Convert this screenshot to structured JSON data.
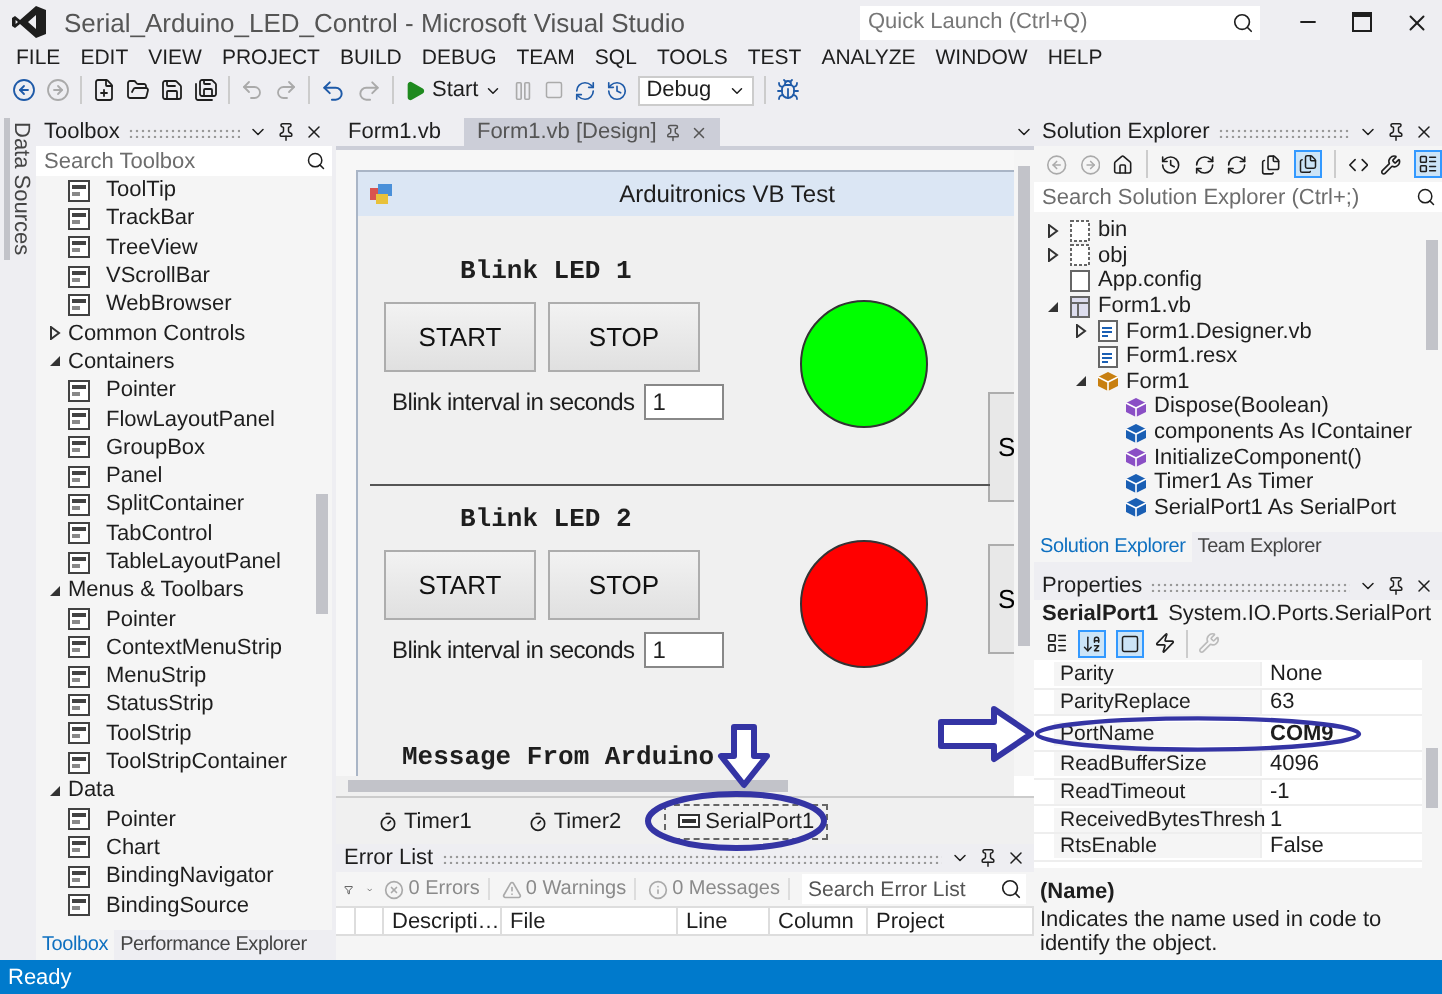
{
  "window": {
    "title": "Serial_Arduino_LED_Control - Microsoft Visual Studio"
  },
  "quick_launch": {
    "placeholder": "Quick Launch (Ctrl+Q)"
  },
  "menu": [
    "FILE",
    "EDIT",
    "VIEW",
    "PROJECT",
    "BUILD",
    "DEBUG",
    "TEAM",
    "SQL",
    "TOOLS",
    "TEST",
    "ANALYZE",
    "WINDOW",
    "HELP"
  ],
  "toolbar": {
    "start": "Start",
    "configuration": "Debug"
  },
  "side_strip": {
    "label": "Data Sources"
  },
  "toolbox": {
    "title": "Toolbox",
    "search": {
      "placeholder": "Search Toolbox"
    },
    "loose_items": [
      "ToolTip",
      "TrackBar",
      "TreeView",
      "VScrollBar",
      "WebBrowser"
    ],
    "groups": [
      {
        "label": "Common Controls",
        "expanded": false
      },
      {
        "label": "Containers",
        "expanded": true,
        "items": [
          "Pointer",
          "FlowLayoutPanel",
          "GroupBox",
          "Panel",
          "SplitContainer",
          "TabControl",
          "TableLayoutPanel"
        ]
      },
      {
        "label": "Menus & Toolbars",
        "expanded": true,
        "items": [
          "Pointer",
          "ContextMenuStrip",
          "MenuStrip",
          "StatusStrip",
          "ToolStrip",
          "ToolStripContainer"
        ]
      },
      {
        "label": "Data",
        "expanded": true,
        "items": [
          "Pointer",
          "Chart",
          "BindingNavigator",
          "BindingSource"
        ]
      }
    ],
    "tabs": [
      {
        "label": "Toolbox",
        "selected": true
      },
      {
        "label": "Performance Explorer",
        "selected": false
      }
    ]
  },
  "documents": {
    "tabs": [
      {
        "label": "Form1.vb",
        "selected": false
      },
      {
        "label": "Form1.vb [Design]",
        "selected": true
      }
    ]
  },
  "form": {
    "title": "Arduitronics VB Test",
    "sections": [
      {
        "title": "Blink LED 1",
        "buttons": [
          "START",
          "STOP"
        ],
        "interval_label": "Blink interval in seconds",
        "interval_value": "1",
        "color": "#00ff00",
        "side_button": "S"
      },
      {
        "title": "Blink LED 2",
        "buttons": [
          "START",
          "STOP"
        ],
        "interval_label": "Blink interval in seconds",
        "interval_value": "1",
        "color": "#ff0000",
        "side_button": "S"
      }
    ],
    "message_label": "Message From Arduino"
  },
  "component_tray": [
    {
      "label": "Timer1",
      "kind": "timer",
      "selected": false,
      "circled": false
    },
    {
      "label": "Timer2",
      "kind": "timer",
      "selected": false,
      "circled": false
    },
    {
      "label": "SerialPort1",
      "kind": "serial_port",
      "selected": true,
      "circled": true
    }
  ],
  "error_list": {
    "title": "Error List",
    "filters": [
      "0 Errors",
      "0 Warnings",
      "0 Messages"
    ],
    "search": {
      "placeholder": "Search Error List"
    },
    "columns": [
      "Descripti…",
      "File",
      "Line",
      "Column",
      "Project"
    ]
  },
  "solution_explorer": {
    "title": "Solution Explorer",
    "search": {
      "placeholder": "Search Solution Explorer (Ctrl+;)"
    },
    "tree": [
      {
        "label": "bin",
        "kind": "folder",
        "expanded": false
      },
      {
        "label": "obj",
        "kind": "folder",
        "expanded": false
      },
      {
        "label": "App.config",
        "kind": "file"
      },
      {
        "label": "Form1.vb",
        "kind": "form",
        "expanded": true,
        "children": [
          {
            "label": "Form1.Designer.vb",
            "kind": "code",
            "expanded": false
          },
          {
            "label": "Form1.resx",
            "kind": "code"
          },
          {
            "label": "Form1",
            "kind": "class",
            "expanded": true,
            "children": [
              {
                "label": "Dispose(Boolean)",
                "kind": "method"
              },
              {
                "label": "components As IContainer",
                "kind": "field"
              },
              {
                "label": "InitializeComponent()",
                "kind": "method"
              },
              {
                "label": "Timer1 As Timer",
                "kind": "field"
              },
              {
                "label": "SerialPort1 As SerialPort",
                "kind": "field"
              }
            ]
          }
        ]
      }
    ],
    "tabs": [
      {
        "label": "Solution Explorer",
        "selected": true
      },
      {
        "label": "Team Explorer",
        "selected": false
      }
    ]
  },
  "properties": {
    "title": "Properties",
    "object": {
      "name": "SerialPort1",
      "type": "System.IO.Ports.SerialPort"
    },
    "rows": [
      {
        "name": "Parity",
        "value": "None",
        "modified": false,
        "circled": false
      },
      {
        "name": "ParityReplace",
        "value": "63",
        "modified": false,
        "circled": false
      },
      {
        "name": "PortName",
        "value": "COM9",
        "modified": true,
        "circled": true
      },
      {
        "name": "ReadBufferSize",
        "value": "4096",
        "modified": false,
        "circled": false
      },
      {
        "name": "ReadTimeout",
        "value": "-1",
        "modified": false,
        "circled": false
      },
      {
        "name": "ReceivedBytesThresh",
        "value": "1",
        "modified": false,
        "circled": false
      },
      {
        "name": "RtsEnable",
        "value": "False",
        "modified": false,
        "circled": false
      }
    ],
    "description": {
      "title": "(Name)",
      "text": "Indicates the name used in code to identify the object."
    }
  },
  "status_bar": {
    "text": "Ready"
  }
}
